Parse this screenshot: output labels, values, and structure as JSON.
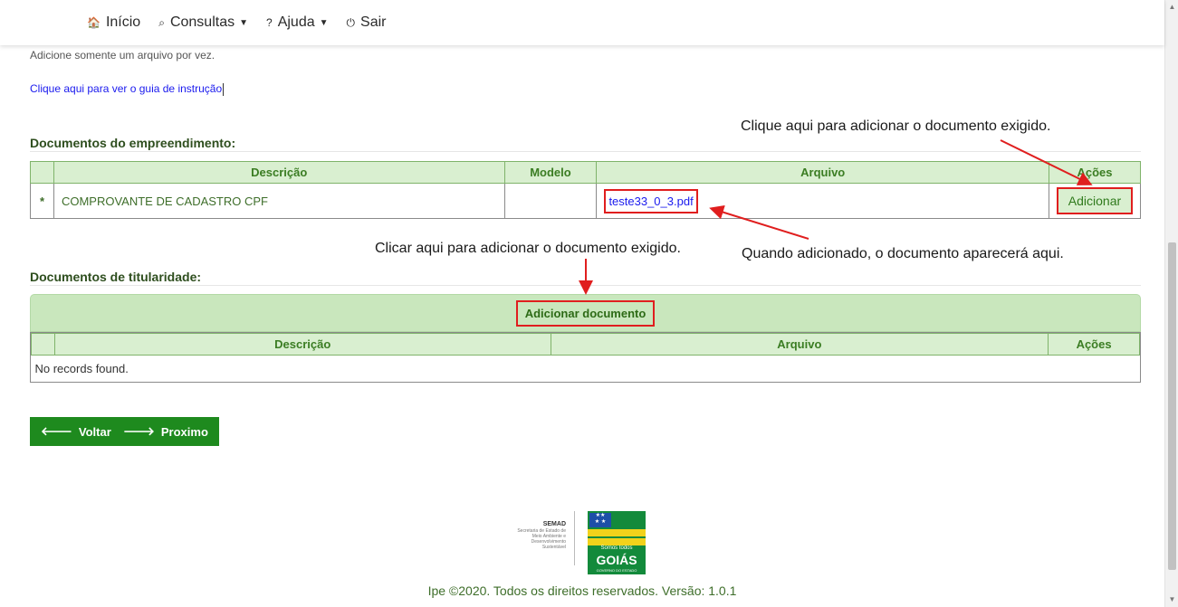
{
  "navbar": {
    "items": [
      {
        "icon": "home-icon",
        "glyph": "🏠",
        "label": "Início"
      },
      {
        "icon": "search-icon",
        "glyph": "⌕",
        "label": "Consultas",
        "dropdown": true
      },
      {
        "icon": "help-icon",
        "glyph": "?",
        "label": "Ajuda",
        "dropdown": true
      },
      {
        "icon": "power-icon",
        "glyph": "⏻",
        "label": "Sair"
      }
    ]
  },
  "page": {
    "note": "Adicione somente um arquivo por vez.",
    "guide_link": "Clique aqui para ver o guia de instrução"
  },
  "section1": {
    "title": "Documentos do empreendimento:",
    "headers": [
      "Descrição",
      "Modelo",
      "Arquivo",
      "Ações"
    ],
    "rows": [
      {
        "required": "*",
        "descricao": "COMPROVANTE DE CADASTRO CPF",
        "modelo": "",
        "arquivo": "teste33_0_3.pdf",
        "acao": "Adicionar"
      }
    ]
  },
  "section2": {
    "title": "Documentos de titularidade:",
    "add_button": "Adicionar documento",
    "headers": [
      "Descrição",
      "Arquivo",
      "Ações"
    ],
    "empty": "No records found."
  },
  "buttons": {
    "back": "Voltar",
    "next": "Proximo"
  },
  "annotations": {
    "a1": "Clique aqui para adicionar o documento exigido.",
    "a2": "Quando adicionado, o documento aparecerá aqui.",
    "a3": "Clicar aqui para adicionar o documento exigido."
  },
  "footer": {
    "semad_title": "SEMAD",
    "semad_sub": "Secretaria de Estado de Meio Ambiente e Desenvolvimento Sustentável",
    "goias_tagline": "Somos todos",
    "goias_name": "GOIÁS",
    "goias_sub": "GOVERNO DO ESTADO",
    "copyright": "Ipe ©2020. Todos os direitos reservados. Versão: 1.0.1"
  },
  "colors": {
    "accent": "#1e8a1e",
    "header_bg": "#d9efd0",
    "annotation_red": "#e01e1e",
    "link_blue": "#1a1aee"
  }
}
